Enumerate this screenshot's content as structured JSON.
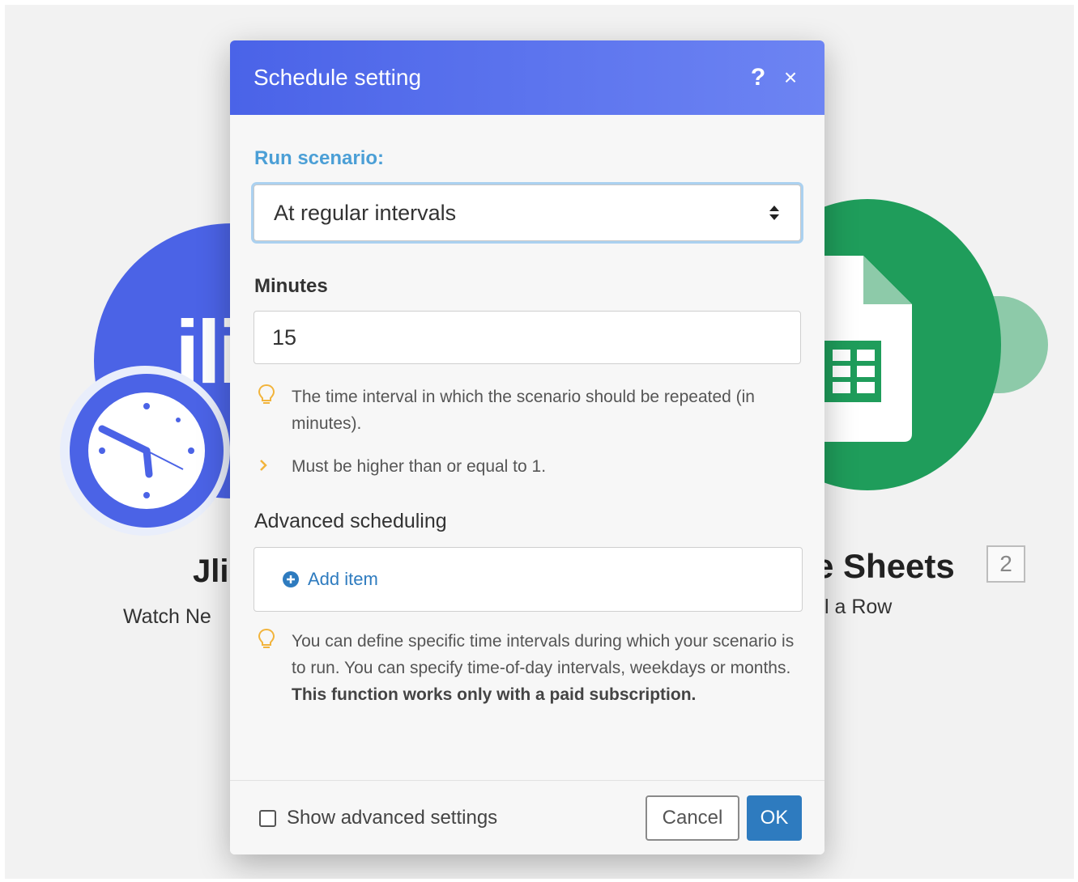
{
  "background": {
    "left_module": {
      "logo_text": "jli",
      "title": "Jli",
      "subtitle": "Watch Ne",
      "icon": "clock-icon"
    },
    "right_module": {
      "title": "e Sheets",
      "subtitle": "l a Row",
      "badge": "2",
      "icon": "google-sheets-icon"
    }
  },
  "modal": {
    "title": "Schedule setting",
    "help_icon": "?",
    "close_icon": "×",
    "run_scenario": {
      "label": "Run scenario:",
      "selected": "At regular intervals"
    },
    "minutes": {
      "label": "Minutes",
      "value": "15",
      "hint": "The time interval in which the scenario should be repeated (in minutes).",
      "rule": "Must be higher than or equal to 1."
    },
    "advanced_scheduling": {
      "label": "Advanced scheduling",
      "add_item": "Add item",
      "hint": "You can define specific time intervals during which your scenario is to run. You can specify time-of-day intervals, weekdays or months.",
      "hint_bold": "This function works only with a paid subscription."
    },
    "footer": {
      "checkbox_label": "Show advanced settings",
      "cancel": "Cancel",
      "ok": "OK"
    }
  },
  "colors": {
    "header_start": "#4a63e8",
    "header_end": "#6d84f3",
    "label_blue": "#4b9fd6",
    "link_blue": "#2e7bbf",
    "jira_blue": "#4b63e6",
    "sheets_green": "#1f9d5b"
  }
}
